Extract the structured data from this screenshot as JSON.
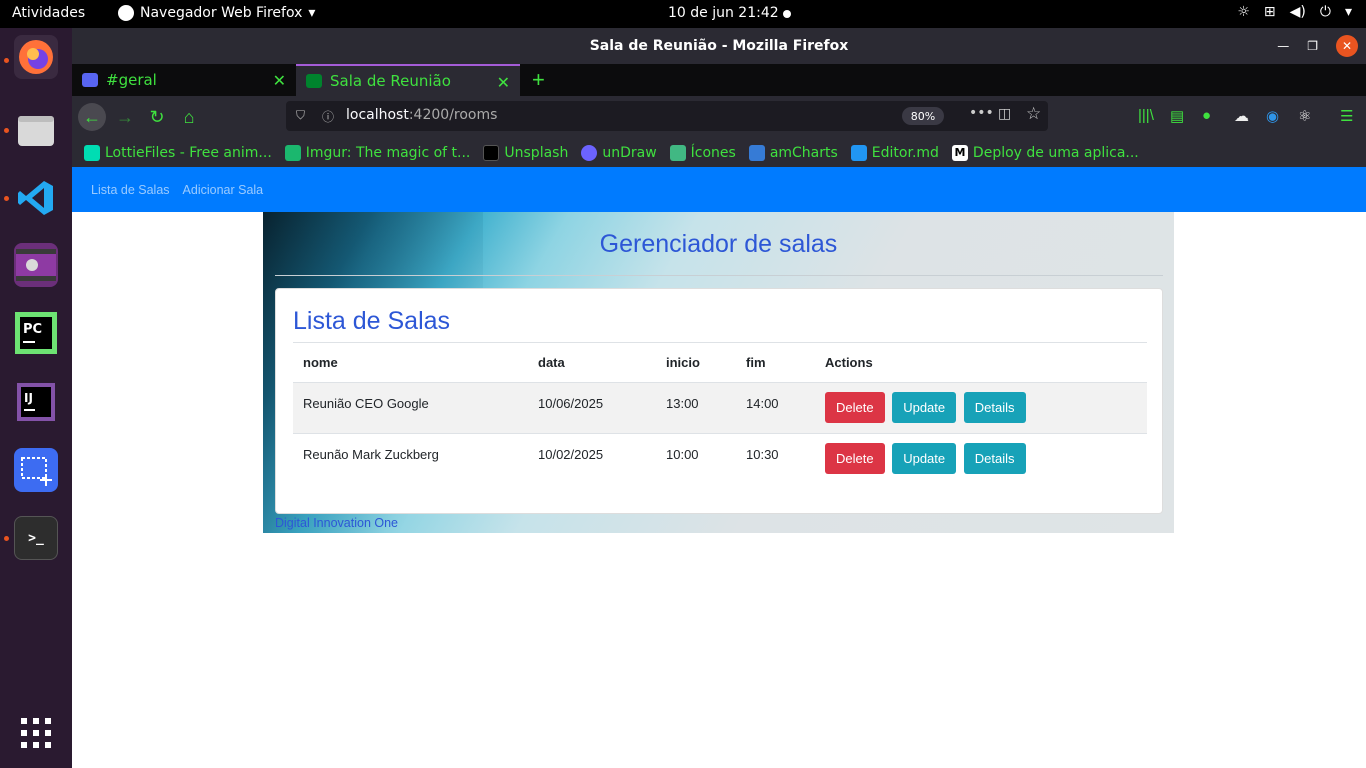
{
  "topbar": {
    "activities": "Atividades",
    "app_menu": "Navegador Web Firefox",
    "clock": "10 de jun  21:42"
  },
  "dock": {
    "items": [
      "firefox",
      "files",
      "vscode",
      "video",
      "pycharm",
      "intellij",
      "screenshot",
      "terminal",
      "show-apps"
    ]
  },
  "window": {
    "title": "Sala de Reunião - Mozilla Firefox"
  },
  "tabs": [
    {
      "label": "#geral",
      "icon": "discord-icon",
      "active": false
    },
    {
      "label": "Sala de Reunião",
      "icon": "meet-icon",
      "active": true
    }
  ],
  "urlbar": {
    "host": "localhost",
    "path": ":4200/rooms",
    "zoom": "80%"
  },
  "bookmarks": [
    {
      "label": "LottieFiles - Free anim...",
      "color": "#00ddb3"
    },
    {
      "label": "Imgur: The magic of t...",
      "color": "#1bb76e"
    },
    {
      "label": "Unsplash",
      "color": "#000000"
    },
    {
      "label": "unDraw",
      "color": "#6c63ff"
    },
    {
      "label": "Ícones",
      "color": "#41b883"
    },
    {
      "label": "amCharts",
      "color": "#367bd6"
    },
    {
      "label": "Editor.md",
      "color": "#2196f3"
    },
    {
      "label": "Deploy de uma aplica...",
      "color": "#111111"
    }
  ],
  "app": {
    "nav": [
      "Lista de Salas",
      "Adicionar Sala"
    ],
    "header": "Gerenciador de salas",
    "card_title": "Lista de Salas",
    "columns": [
      "nome",
      "data",
      "inicio",
      "fim",
      "Actions"
    ],
    "rows": [
      {
        "nome": "Reunião CEO Google",
        "data": "10/06/2025",
        "inicio": "13:00",
        "fim": "14:00"
      },
      {
        "nome": "Reunão Mark Zuckberg",
        "data": "10/02/2025",
        "inicio": "10:00",
        "fim": "10:30"
      }
    ],
    "actions": {
      "delete": "Delete",
      "update": "Update",
      "details": "Details"
    },
    "footer": "Digital Innovation One"
  }
}
